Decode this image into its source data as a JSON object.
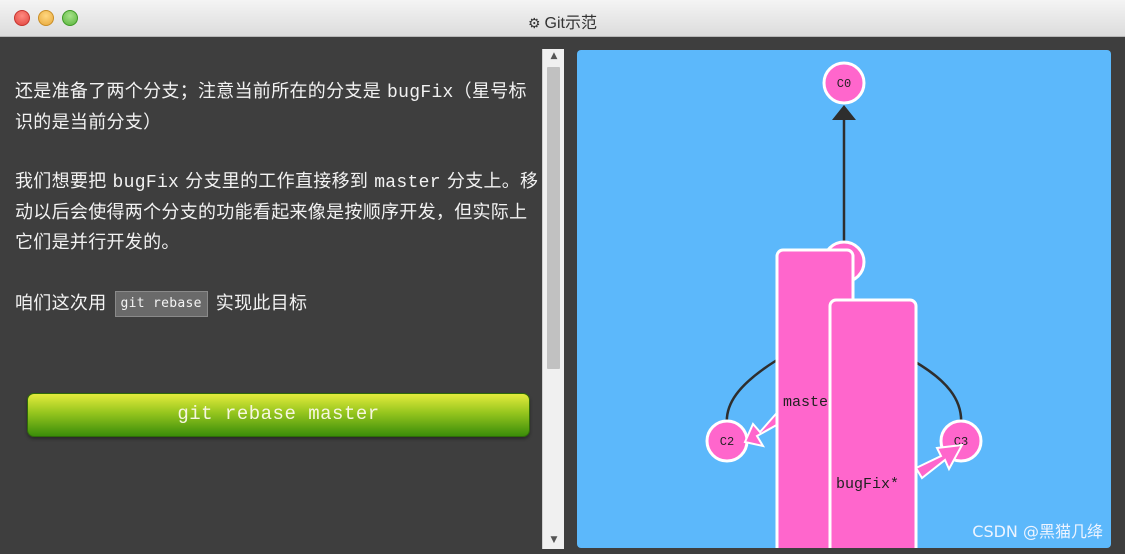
{
  "window": {
    "title": "Git示范",
    "gear_icon": "⚙"
  },
  "instructions": {
    "para1": [
      {
        "text": "还是准备了两个分支；注意当前所在的分支是 ",
        "mono": false
      },
      {
        "text": "bugFix",
        "mono": true
      },
      {
        "text": "（星号标识的是当前分支）",
        "mono": false
      }
    ],
    "para2": [
      {
        "text": "我们想要把 ",
        "mono": false
      },
      {
        "text": "bugFix",
        "mono": true
      },
      {
        "text": " 分支里的工作直接移到 ",
        "mono": false
      },
      {
        "text": "master",
        "mono": true
      },
      {
        "text": " 分支上。移动以后会使得两个分支的功能看起来像是按顺序开发，但实际上它们是并行开发的。",
        "mono": false
      }
    ],
    "para3_prefix": "咱们这次用",
    "code_badge": "git rebase",
    "para3_suffix": "实现此目标"
  },
  "command_button": {
    "label": "git rebase master"
  },
  "graph": {
    "nodes": [
      {
        "id": "c0",
        "label": "C0"
      },
      {
        "id": "c1",
        "label": "C1"
      },
      {
        "id": "c2",
        "label": "C2"
      },
      {
        "id": "c3",
        "label": "C3"
      }
    ],
    "branches": [
      {
        "name": "master",
        "visible_label": "maste"
      },
      {
        "name": "bugFix",
        "visible_label": "bugFix*"
      }
    ],
    "colors": {
      "background": "#5cb8fb",
      "node_fill": "#ff66cc",
      "edge": "#2e2e2e"
    }
  },
  "watermark": "CSDN @黑猫几绛"
}
